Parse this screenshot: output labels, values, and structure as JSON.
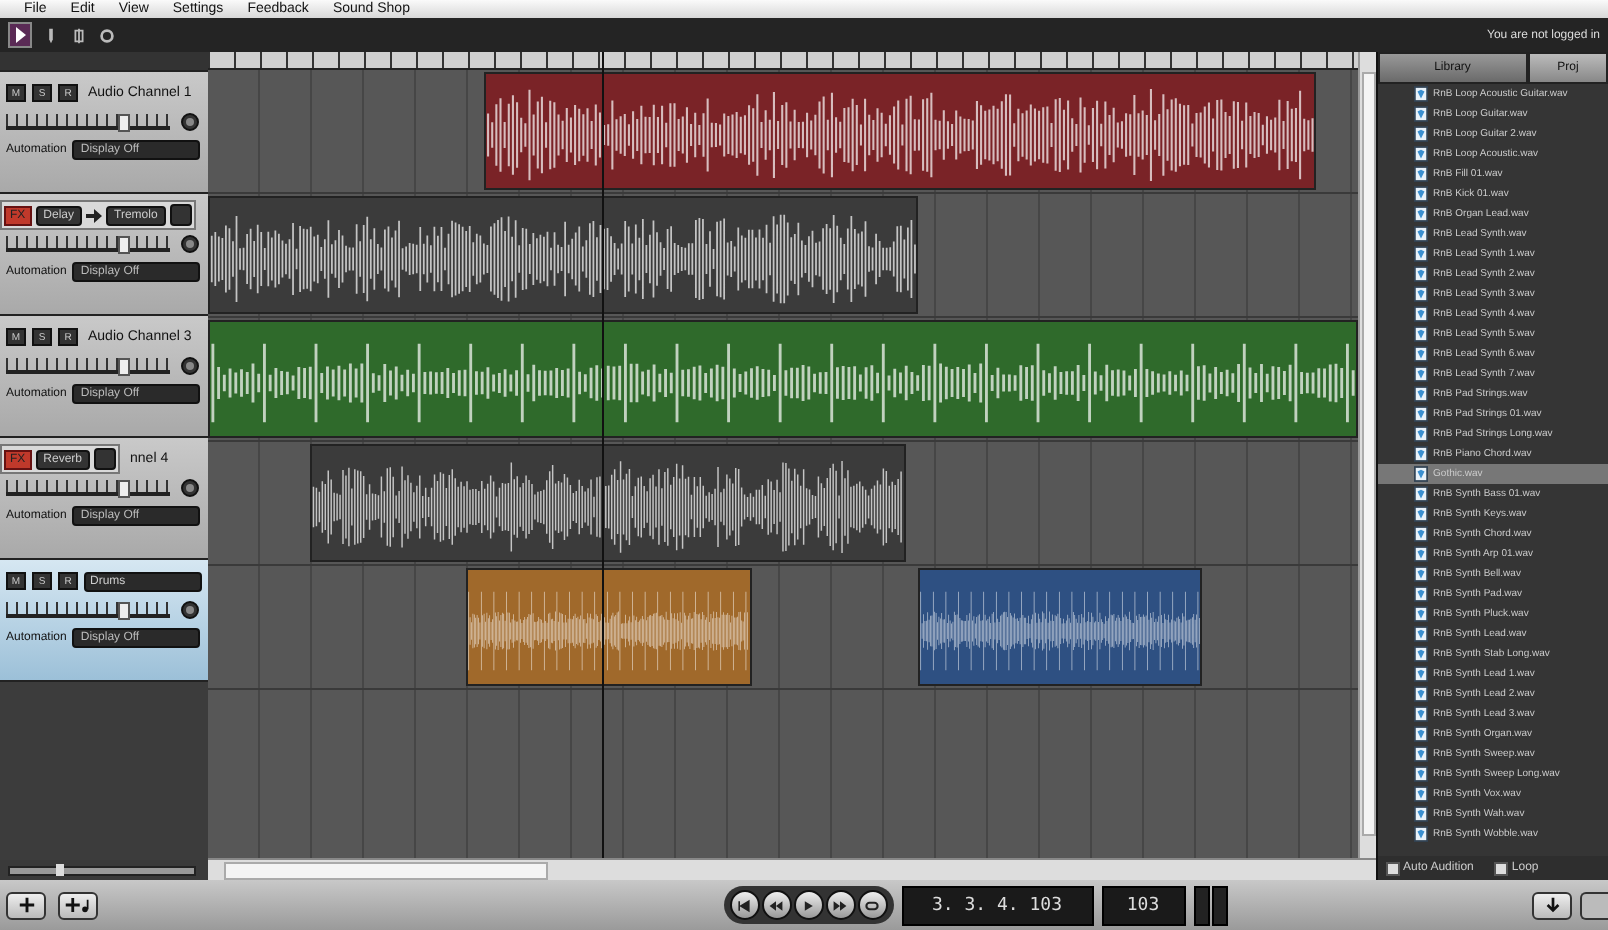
{
  "menu": [
    "File",
    "Edit",
    "View",
    "Settings",
    "Feedback",
    "Sound Shop"
  ],
  "login_status": "You are not logged in",
  "tracks": [
    {
      "name": "Audio Channel 1",
      "selected": false,
      "buttons": [
        "M",
        "S",
        "R"
      ],
      "automation_label": "Automation",
      "automation": "Display Off",
      "clips": [
        {
          "color": "#7a2327"
        }
      ]
    },
    {
      "selected": false,
      "fx_button": "FX",
      "fx": [
        "Delay",
        "Tremolo"
      ],
      "automation_label": "Automation",
      "automation": "Display Off",
      "clips": [
        {
          "color": "#3b3b3b"
        }
      ]
    },
    {
      "name": "Audio Channel 3",
      "selected": false,
      "buttons": [
        "M",
        "S",
        "R"
      ],
      "automation_label": "Automation",
      "automation": "Display Off",
      "clips": [
        {
          "color": "#2f6a2b"
        }
      ]
    },
    {
      "name": "nnel 4",
      "selected": false,
      "fx_button": "FX",
      "fx": [
        "Reverb"
      ],
      "automation_label": "Automation",
      "automation": "Display Off",
      "clips": [
        {
          "color": "#3b3b3b"
        }
      ]
    },
    {
      "name": "Drums",
      "selected": true,
      "buttons": [
        "M",
        "S",
        "R"
      ],
      "automation_label": "Automation",
      "automation": "Display Off",
      "clips": [
        {
          "color": "#a0692b"
        },
        {
          "color": "#2e5082"
        }
      ]
    }
  ],
  "zoom": {
    "level": 0.25
  },
  "library": {
    "tabs": [
      {
        "label": "Library",
        "selected": true
      },
      {
        "label": "Proj",
        "selected": false
      }
    ],
    "files": [
      {
        "name": "RnB Loop Acoustic Guitar.wav",
        "selected": false
      },
      {
        "name": "RnB Loop Guitar.wav",
        "selected": false
      },
      {
        "name": "RnB Loop Guitar 2.wav",
        "selected": false
      },
      {
        "name": "RnB Loop Acoustic.wav",
        "selected": false
      },
      {
        "name": "RnB Fill 01.wav",
        "selected": false
      },
      {
        "name": "RnB Kick 01.wav",
        "selected": false
      },
      {
        "name": "RnB Organ Lead.wav",
        "selected": false
      },
      {
        "name": "RnB Lead Synth.wav",
        "selected": false
      },
      {
        "name": "RnB Lead Synth 1.wav",
        "selected": false
      },
      {
        "name": "RnB Lead Synth 2.wav",
        "selected": false
      },
      {
        "name": "RnB Lead Synth 3.wav",
        "selected": false
      },
      {
        "name": "RnB Lead Synth 4.wav",
        "selected": false
      },
      {
        "name": "RnB Lead Synth 5.wav",
        "selected": false
      },
      {
        "name": "RnB Lead Synth 6.wav",
        "selected": false
      },
      {
        "name": "RnB Lead Synth 7.wav",
        "selected": false
      },
      {
        "name": "RnB Pad Strings.wav",
        "selected": false
      },
      {
        "name": "RnB Pad Strings 01.wav",
        "selected": false
      },
      {
        "name": "RnB Pad Strings Long.wav",
        "selected": false
      },
      {
        "name": "RnB Piano Chord.wav",
        "selected": false
      },
      {
        "name": "Gothic.wav",
        "selected": true
      },
      {
        "name": "RnB Synth Bass 01.wav",
        "selected": false
      },
      {
        "name": "RnB Synth Keys.wav",
        "selected": false
      },
      {
        "name": "RnB Synth Chord.wav",
        "selected": false
      },
      {
        "name": "RnB Synth Arp 01.wav",
        "selected": false
      },
      {
        "name": "RnB Synth Bell.wav",
        "selected": false
      },
      {
        "name": "RnB Synth Pad.wav",
        "selected": false
      },
      {
        "name": "RnB Synth Pluck.wav",
        "selected": false
      },
      {
        "name": "RnB Synth Lead.wav",
        "selected": false
      },
      {
        "name": "RnB Synth Stab Long.wav",
        "selected": false
      },
      {
        "name": "RnB Synth Lead 1.wav",
        "selected": false
      },
      {
        "name": "RnB Synth Lead 2.wav",
        "selected": false
      },
      {
        "name": "RnB Synth Lead 3.wav",
        "selected": false
      },
      {
        "name": "RnB Synth Organ.wav",
        "selected": false
      },
      {
        "name": "RnB Synth Sweep.wav",
        "selected": false
      },
      {
        "name": "RnB Synth Sweep Long.wav",
        "selected": false
      },
      {
        "name": "RnB Synth Vox.wav",
        "selected": false
      },
      {
        "name": "RnB Synth Wah.wav",
        "selected": false
      },
      {
        "name": "RnB Synth Wobble.wav",
        "selected": false
      }
    ],
    "options": [
      {
        "label": "Auto Audition",
        "checked": false
      },
      {
        "label": "Loop",
        "checked": false
      }
    ]
  },
  "transport": {
    "position": "3. 3. 4. 103",
    "tempo": "103"
  }
}
